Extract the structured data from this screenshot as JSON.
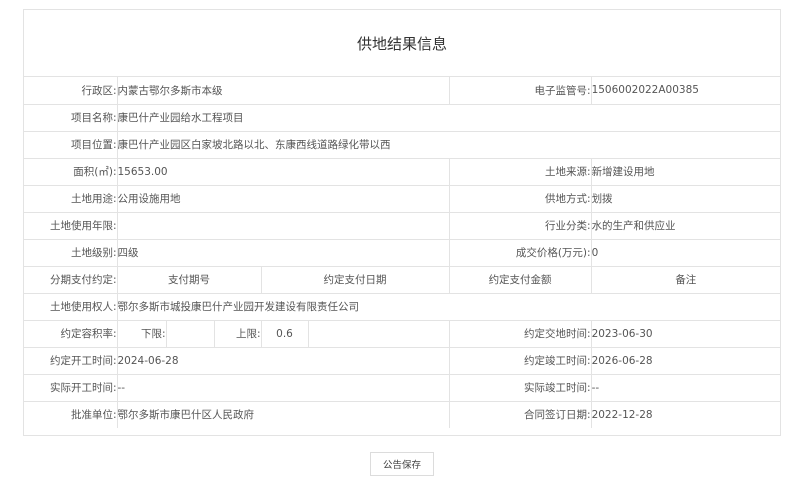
{
  "title": "供地结果信息",
  "fields": {
    "district_label": "行政区:",
    "district_value": "内蒙古鄂尔多斯市本级",
    "supervision_label": "电子监管号:",
    "supervision_value": "1506002022A00385",
    "project_name_label": "项目名称:",
    "project_name_value": "康巴什产业园给水工程项目",
    "project_location_label": "项目位置:",
    "project_location_value": "康巴什产业园区白家坡北路以北、东康西线道路绿化带以西",
    "area_label": "面积(㎡):",
    "area_value": "15653.00",
    "land_source_label": "土地来源:",
    "land_source_value": "新增建设用地",
    "land_use_label": "土地用途:",
    "land_use_value": "公用设施用地",
    "supply_method_label": "供地方式:",
    "supply_method_value": "划拨",
    "use_years_label": "土地使用年限:",
    "use_years_value": "",
    "industry_label": "行业分类:",
    "industry_value": "水的生产和供应业",
    "land_grade_label": "土地级别:",
    "land_grade_value": "四级",
    "price_label": "成交价格(万元):",
    "price_value": "0",
    "installment_label": "分期支付约定:",
    "installment_col_period": "支付期号",
    "installment_col_date": "约定支付日期",
    "installment_col_amount": "约定支付金额",
    "installment_col_note": "备注",
    "owner_label": "土地使用权人:",
    "owner_value": "鄂尔多斯市城投康巴什产业园开发建设有限责任公司",
    "far_label": "约定容积率:",
    "far_lower_label": "下限:",
    "far_lower_value": "",
    "far_upper_label": "上限:",
    "far_upper_value": "0.6",
    "delivery_label": "约定交地时间:",
    "delivery_value": "2023-06-30",
    "planned_start_label": "约定开工时间:",
    "planned_start_value": "2024-06-28",
    "planned_finish_label": "约定竣工时间:",
    "planned_finish_value": "2026-06-28",
    "actual_start_label": "实际开工时间:",
    "actual_start_value": "--",
    "actual_finish_label": "实际竣工时间:",
    "actual_finish_value": "--",
    "approver_label": "批准单位:",
    "approver_value": "鄂尔多斯市康巴什区人民政府",
    "contract_date_label": "合同签订日期:",
    "contract_date_value": "2022-12-28"
  },
  "save_button": "公告保存"
}
